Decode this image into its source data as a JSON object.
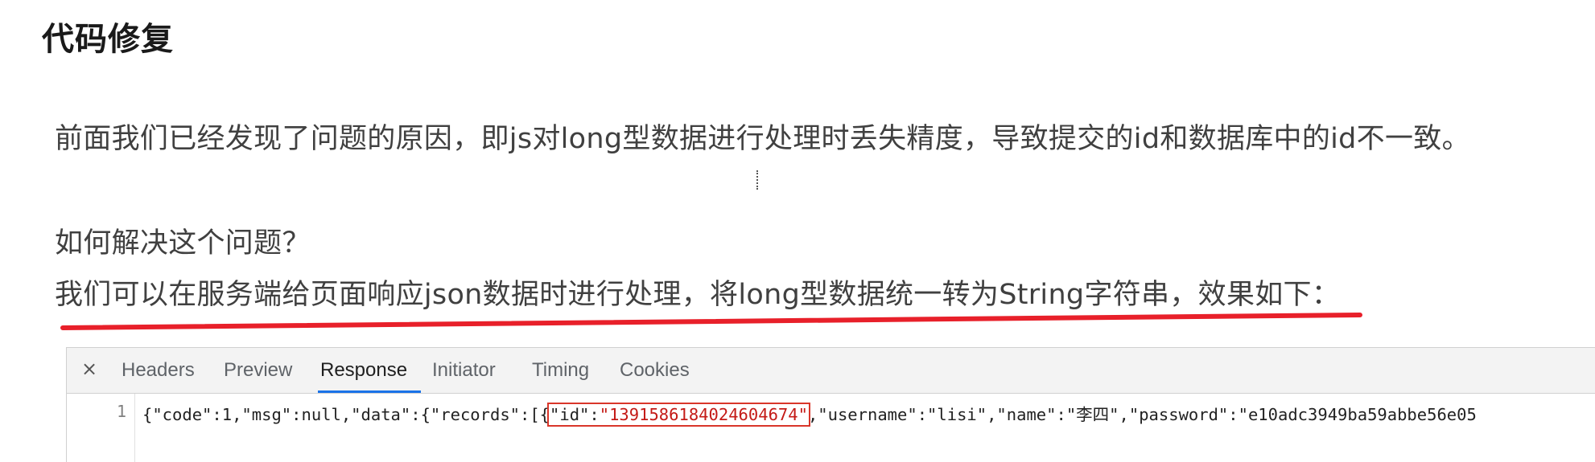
{
  "doc": {
    "title": "代码修复",
    "paragraph1": "前面我们已经发现了问题的原因，即js对long型数据进行处理时丢失精度，导致提交的id和数据库中的id不一致。",
    "paragraph2": "如何解决这个问题？",
    "paragraph3": "我们可以在服务端给页面响应json数据时进行处理，将long型数据统一转为String字符串，效果如下："
  },
  "annotation": {
    "underline_color": "#e8202a",
    "box_color": "#d9362a"
  },
  "devtools": {
    "close_symbol": "×",
    "tabs": [
      "Headers",
      "Preview",
      "Response",
      "Initiator",
      "Timing",
      "Cookies"
    ],
    "active_tab": "Response",
    "accent_color": "#1a73e8",
    "line_number": "1",
    "code": {
      "prefix": "{\"code\":1,\"msg\":null,\"data\":{\"records\":[{",
      "id_key": "\"id\"",
      "colon": ":",
      "id_value": "\"1391586184024604674\"",
      "suffix_part1": ",\"username\":\"lisi\",\"name\":\"李四\",\"password\":\"e10adc3949ba59abbe56e05"
    }
  }
}
